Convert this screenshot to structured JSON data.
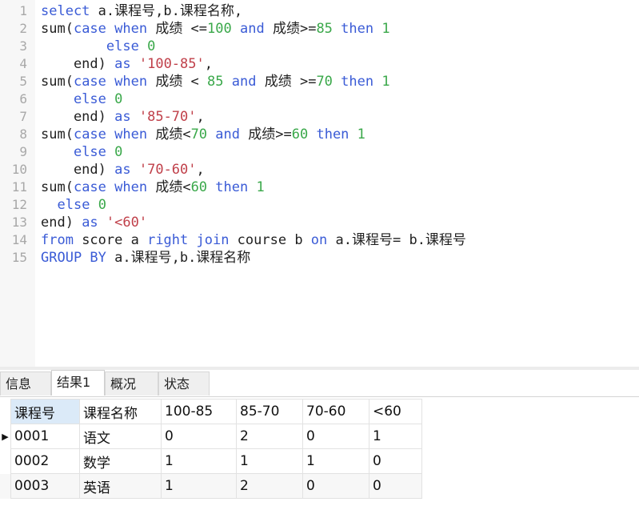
{
  "editor": {
    "lines": [
      {
        "num": "1",
        "tokens": [
          {
            "t": "select",
            "c": "kw"
          },
          {
            "t": " a.课程号,b.课程名称,",
            "c": "plain"
          }
        ]
      },
      {
        "num": "2",
        "tokens": [
          {
            "t": "sum(",
            "c": "plain"
          },
          {
            "t": "case when",
            "c": "kw"
          },
          {
            "t": " 成绩 <=",
            "c": "plain"
          },
          {
            "t": "100",
            "c": "num"
          },
          {
            "t": " ",
            "c": "plain"
          },
          {
            "t": "and",
            "c": "kw"
          },
          {
            "t": " 成绩>=",
            "c": "plain"
          },
          {
            "t": "85",
            "c": "num"
          },
          {
            "t": " ",
            "c": "plain"
          },
          {
            "t": "then",
            "c": "kw"
          },
          {
            "t": " ",
            "c": "plain"
          },
          {
            "t": "1",
            "c": "num"
          }
        ]
      },
      {
        "num": "3",
        "tokens": [
          {
            "t": "        ",
            "c": "plain"
          },
          {
            "t": "else",
            "c": "kw"
          },
          {
            "t": " ",
            "c": "plain"
          },
          {
            "t": "0",
            "c": "num"
          }
        ]
      },
      {
        "num": "4",
        "tokens": [
          {
            "t": "    end) ",
            "c": "plain"
          },
          {
            "t": "as",
            "c": "kw"
          },
          {
            "t": " ",
            "c": "plain"
          },
          {
            "t": "'100-85'",
            "c": "str"
          },
          {
            "t": ",",
            "c": "plain"
          }
        ]
      },
      {
        "num": "5",
        "tokens": [
          {
            "t": "sum(",
            "c": "plain"
          },
          {
            "t": "case when",
            "c": "kw"
          },
          {
            "t": " 成绩 < ",
            "c": "plain"
          },
          {
            "t": "85",
            "c": "num"
          },
          {
            "t": " ",
            "c": "plain"
          },
          {
            "t": "and",
            "c": "kw"
          },
          {
            "t": " 成绩 >=",
            "c": "plain"
          },
          {
            "t": "70",
            "c": "num"
          },
          {
            "t": " ",
            "c": "plain"
          },
          {
            "t": "then",
            "c": "kw"
          },
          {
            "t": " ",
            "c": "plain"
          },
          {
            "t": "1",
            "c": "num"
          }
        ]
      },
      {
        "num": "6",
        "tokens": [
          {
            "t": "    ",
            "c": "plain"
          },
          {
            "t": "else",
            "c": "kw"
          },
          {
            "t": " ",
            "c": "plain"
          },
          {
            "t": "0",
            "c": "num"
          }
        ]
      },
      {
        "num": "7",
        "tokens": [
          {
            "t": "    end) ",
            "c": "plain"
          },
          {
            "t": "as",
            "c": "kw"
          },
          {
            "t": " ",
            "c": "plain"
          },
          {
            "t": "'85-70'",
            "c": "str"
          },
          {
            "t": ",",
            "c": "plain"
          }
        ]
      },
      {
        "num": "8",
        "tokens": [
          {
            "t": "sum(",
            "c": "plain"
          },
          {
            "t": "case when",
            "c": "kw"
          },
          {
            "t": " 成绩<",
            "c": "plain"
          },
          {
            "t": "70",
            "c": "num"
          },
          {
            "t": " ",
            "c": "plain"
          },
          {
            "t": "and",
            "c": "kw"
          },
          {
            "t": " 成绩>=",
            "c": "plain"
          },
          {
            "t": "60",
            "c": "num"
          },
          {
            "t": " ",
            "c": "plain"
          },
          {
            "t": "then",
            "c": "kw"
          },
          {
            "t": " ",
            "c": "plain"
          },
          {
            "t": "1",
            "c": "num"
          }
        ]
      },
      {
        "num": "9",
        "tokens": [
          {
            "t": "    ",
            "c": "plain"
          },
          {
            "t": "else",
            "c": "kw"
          },
          {
            "t": " ",
            "c": "plain"
          },
          {
            "t": "0",
            "c": "num"
          }
        ]
      },
      {
        "num": "10",
        "tokens": [
          {
            "t": "    end) ",
            "c": "plain"
          },
          {
            "t": "as",
            "c": "kw"
          },
          {
            "t": " ",
            "c": "plain"
          },
          {
            "t": "'70-60'",
            "c": "str"
          },
          {
            "t": ",",
            "c": "plain"
          }
        ]
      },
      {
        "num": "11",
        "tokens": [
          {
            "t": "sum(",
            "c": "plain"
          },
          {
            "t": "case when",
            "c": "kw"
          },
          {
            "t": " 成绩<",
            "c": "plain"
          },
          {
            "t": "60",
            "c": "num"
          },
          {
            "t": " ",
            "c": "plain"
          },
          {
            "t": "then",
            "c": "kw"
          },
          {
            "t": " ",
            "c": "plain"
          },
          {
            "t": "1",
            "c": "num"
          }
        ]
      },
      {
        "num": "12",
        "tokens": [
          {
            "t": "  ",
            "c": "plain"
          },
          {
            "t": "else",
            "c": "kw"
          },
          {
            "t": " ",
            "c": "plain"
          },
          {
            "t": "0",
            "c": "num"
          }
        ]
      },
      {
        "num": "13",
        "tokens": [
          {
            "t": "end) ",
            "c": "plain"
          },
          {
            "t": "as",
            "c": "kw"
          },
          {
            "t": " ",
            "c": "plain"
          },
          {
            "t": "'<60'",
            "c": "str"
          }
        ]
      },
      {
        "num": "14",
        "tokens": [
          {
            "t": "from",
            "c": "kw"
          },
          {
            "t": " score a ",
            "c": "plain"
          },
          {
            "t": "right join",
            "c": "kw"
          },
          {
            "t": " course b ",
            "c": "plain"
          },
          {
            "t": "on",
            "c": "kw"
          },
          {
            "t": " a.课程号= b.课程号",
            "c": "plain"
          }
        ]
      },
      {
        "num": "15",
        "tokens": [
          {
            "t": "GROUP BY",
            "c": "kw"
          },
          {
            "t": " a.课程号,b.课程名称",
            "c": "plain"
          }
        ]
      }
    ]
  },
  "tabs": [
    {
      "label": "信息",
      "active": false
    },
    {
      "label": "结果1",
      "active": true
    },
    {
      "label": "概况",
      "active": false
    },
    {
      "label": "状态",
      "active": false
    }
  ],
  "results": {
    "columns": [
      "课程号",
      "课程名称",
      "100-85",
      "85-70",
      "70-60",
      "<60"
    ],
    "rows": [
      [
        "0001",
        "语文",
        "0",
        "2",
        "0",
        "1"
      ],
      [
        "0002",
        "数学",
        "1",
        "1",
        "1",
        "0"
      ],
      [
        "0003",
        "英语",
        "1",
        "2",
        "0",
        "0"
      ]
    ],
    "current_row_marker": "▶"
  },
  "colors": {
    "keyword": "#3a5bd6",
    "number": "#3aa84a",
    "string": "#c0404a",
    "selected_header": "#dbeaf8"
  }
}
